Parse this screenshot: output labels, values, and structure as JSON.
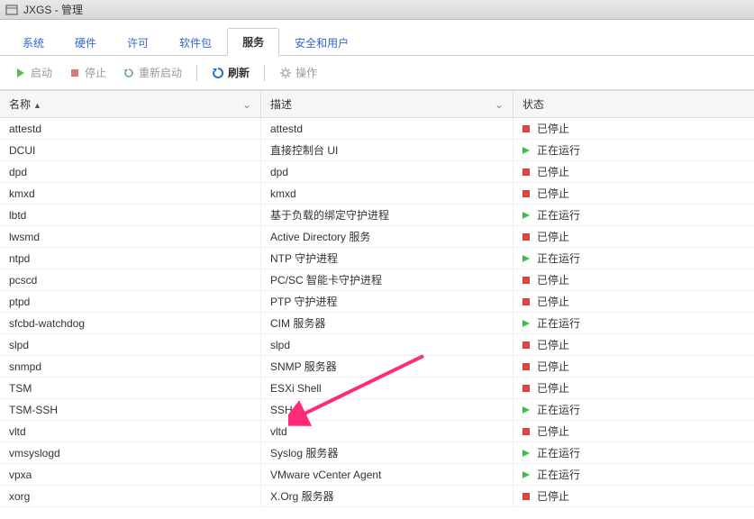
{
  "window": {
    "title": "JXGS - 管理"
  },
  "tabs": [
    {
      "label": "系统",
      "active": false
    },
    {
      "label": "硬件",
      "active": false
    },
    {
      "label": "许可",
      "active": false
    },
    {
      "label": "软件包",
      "active": false
    },
    {
      "label": "服务",
      "active": true
    },
    {
      "label": "安全和用户",
      "active": false
    }
  ],
  "toolbar": {
    "start": "启动",
    "stop": "停止",
    "restart": "重新启动",
    "refresh": "刷新",
    "actions": "操作"
  },
  "columns": {
    "name": "名称",
    "desc": "描述",
    "status": "状态"
  },
  "status_labels": {
    "stopped": "已停止",
    "running": "正在运行"
  },
  "services": [
    {
      "name": "attestd",
      "desc": "attestd",
      "status": "stopped"
    },
    {
      "name": "DCUI",
      "desc": "直接控制台 UI",
      "status": "running"
    },
    {
      "name": "dpd",
      "desc": "dpd",
      "status": "stopped"
    },
    {
      "name": "kmxd",
      "desc": "kmxd",
      "status": "stopped"
    },
    {
      "name": "lbtd",
      "desc": "基于负载的绑定守护进程",
      "status": "running"
    },
    {
      "name": "lwsmd",
      "desc": "Active Directory 服务",
      "status": "stopped"
    },
    {
      "name": "ntpd",
      "desc": "NTP 守护进程",
      "status": "running"
    },
    {
      "name": "pcscd",
      "desc": "PC/SC 智能卡守护进程",
      "status": "stopped"
    },
    {
      "name": "ptpd",
      "desc": "PTP 守护进程",
      "status": "stopped"
    },
    {
      "name": "sfcbd-watchdog",
      "desc": "CIM 服务器",
      "status": "running"
    },
    {
      "name": "slpd",
      "desc": "slpd",
      "status": "stopped"
    },
    {
      "name": "snmpd",
      "desc": "SNMP 服务器",
      "status": "stopped"
    },
    {
      "name": "TSM",
      "desc": "ESXi Shell",
      "status": "stopped"
    },
    {
      "name": "TSM-SSH",
      "desc": "SSH",
      "status": "running"
    },
    {
      "name": "vltd",
      "desc": "vltd",
      "status": "stopped"
    },
    {
      "name": "vmsyslogd",
      "desc": "Syslog 服务器",
      "status": "running"
    },
    {
      "name": "vpxa",
      "desc": "VMware vCenter Agent",
      "status": "running"
    },
    {
      "name": "xorg",
      "desc": "X.Org 服务器",
      "status": "stopped"
    }
  ]
}
